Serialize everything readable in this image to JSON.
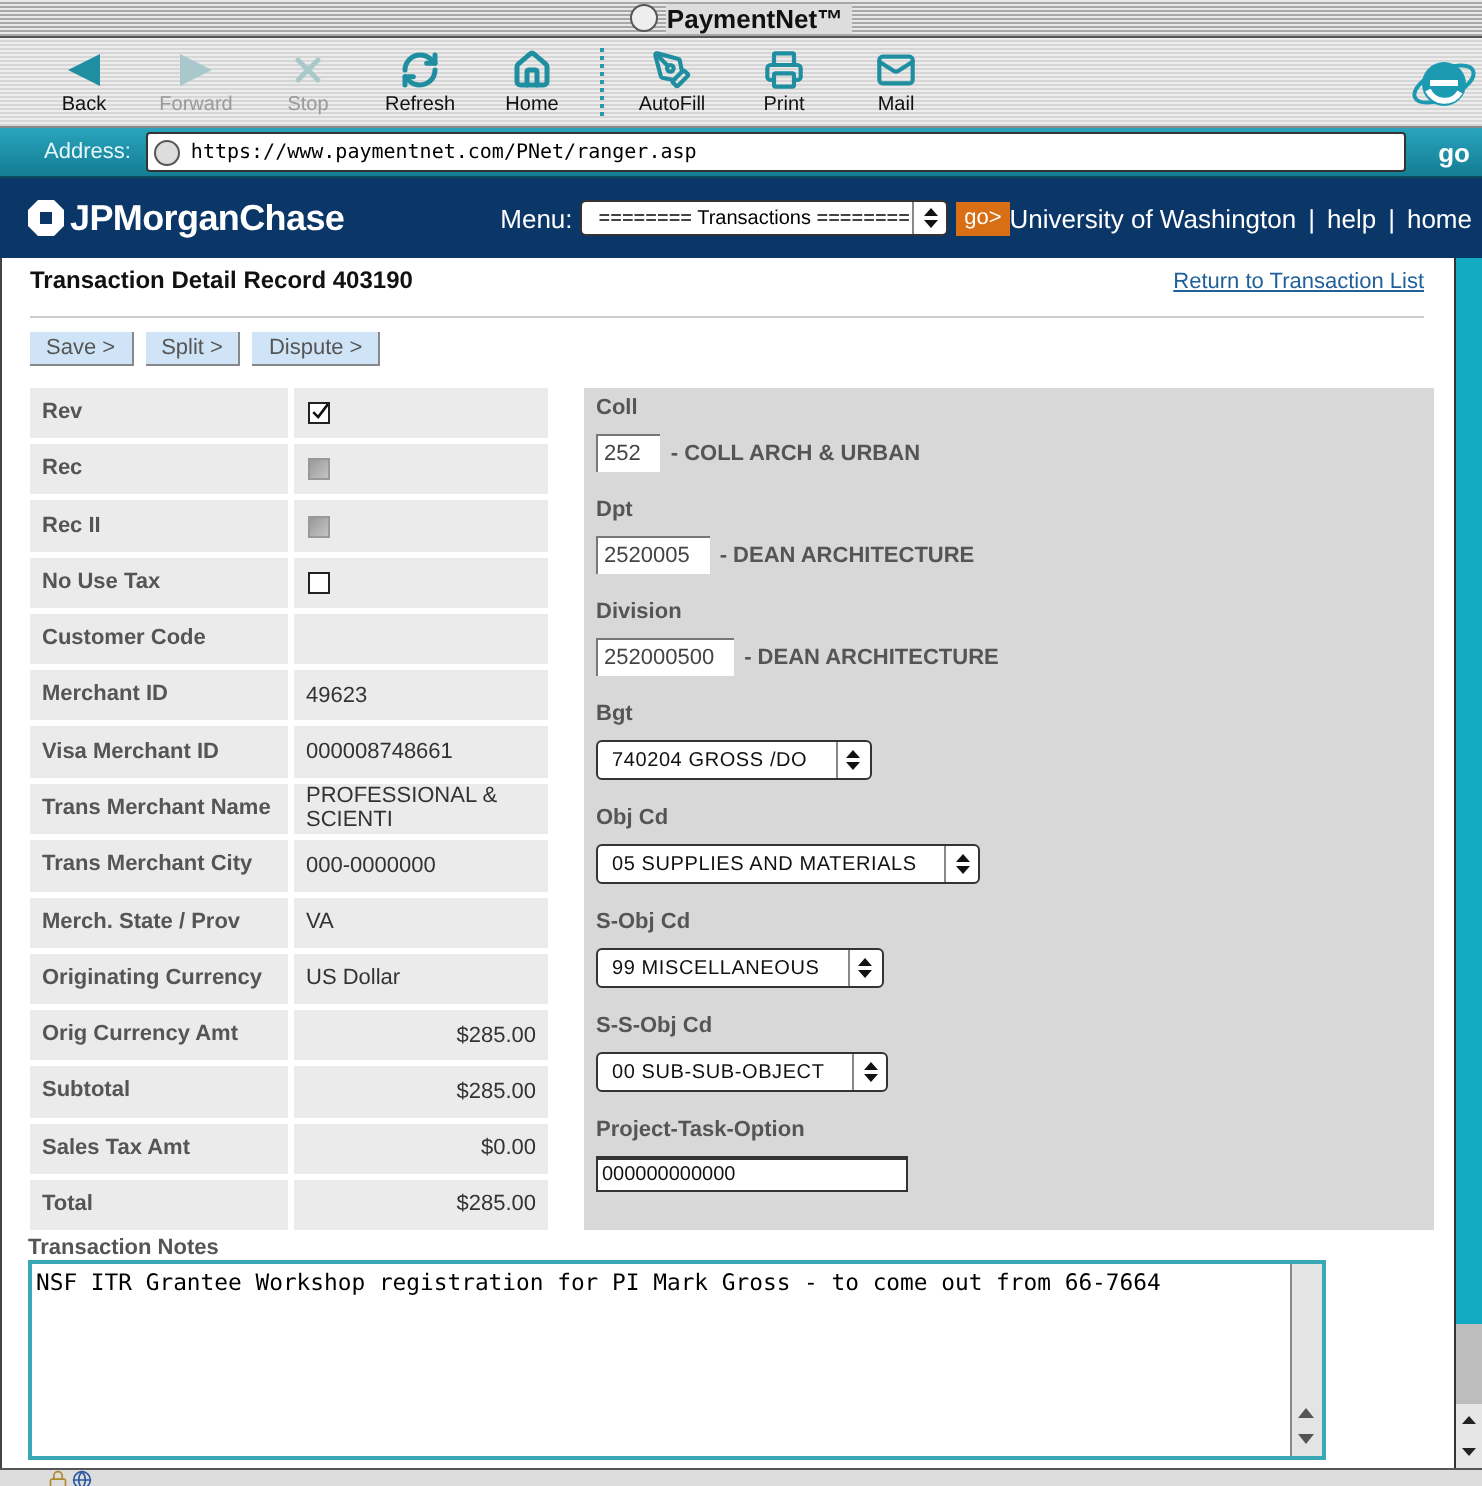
{
  "window": {
    "title": "PaymentNet™"
  },
  "toolbar": {
    "navigation": [
      {
        "kind": "back",
        "label": "Back",
        "disabled": false
      },
      {
        "kind": "forward",
        "label": "Forward",
        "disabled": true
      },
      {
        "kind": "stop",
        "label": "Stop",
        "disabled": true
      },
      {
        "kind": "refresh",
        "label": "Refresh",
        "disabled": false
      },
      {
        "kind": "home",
        "label": "Home",
        "disabled": false
      }
    ],
    "tools": [
      {
        "kind": "autofill",
        "label": "AutoFill",
        "disabled": false
      },
      {
        "kind": "print",
        "label": "Print",
        "disabled": false
      },
      {
        "kind": "mail",
        "label": "Mail",
        "disabled": false
      }
    ]
  },
  "address_bar": {
    "label": "Address:",
    "url": "https://www.paymentnet.com/PNet/ranger.asp",
    "go": "go"
  },
  "header": {
    "logo": "JPMorganChase",
    "menu_label": "Menu:",
    "menu_value": "======== Transactions ========",
    "go": "go>",
    "nav": [
      {
        "kind": "link",
        "text": "University of Washington"
      },
      {
        "kind": "separator",
        "text": "|"
      },
      {
        "kind": "link",
        "text": "help"
      },
      {
        "kind": "separator",
        "text": "|"
      },
      {
        "kind": "link",
        "text": "home"
      }
    ]
  },
  "page": {
    "title": "Transaction Detail Record 403190",
    "back_link": "Return to Transaction List",
    "actions": [
      "Save >",
      "Split >",
      "Dispute >"
    ]
  },
  "details": [
    {
      "label": "Rev",
      "kind": "checkbox",
      "checked": true,
      "disabled": false
    },
    {
      "label": "Rec",
      "kind": "checkbox",
      "checked": false,
      "disabled": true
    },
    {
      "label": "Rec II",
      "kind": "checkbox",
      "checked": false,
      "disabled": true
    },
    {
      "label": "No Use Tax",
      "kind": "checkbox",
      "checked": false,
      "disabled": false
    },
    {
      "label": "Customer Code",
      "kind": "text"
    },
    {
      "label": "Merchant ID",
      "kind": "text",
      "value": "49623"
    },
    {
      "label": "Visa Merchant ID",
      "kind": "text",
      "value": "000008748661"
    },
    {
      "label": "Trans Merchant Name",
      "kind": "text",
      "value": "PROFESSIONAL & SCIENTI"
    },
    {
      "label": "Trans Merchant City",
      "kind": "text",
      "value": "000-0000000"
    },
    {
      "label": "Merch. State / Prov",
      "kind": "text",
      "value": "VA"
    },
    {
      "label": "Originating Currency",
      "kind": "text",
      "value": "US Dollar"
    },
    {
      "label": "Orig Currency Amt",
      "kind": "amount",
      "value": "$285.00"
    },
    {
      "label": "Subtotal",
      "kind": "amount",
      "value": "$285.00"
    },
    {
      "label": "Sales Tax Amt",
      "kind": "amount",
      "value": "$0.00"
    },
    {
      "label": "Total",
      "kind": "amount",
      "value": "$285.00"
    }
  ],
  "accounting": [
    {
      "label": "Coll",
      "kind": "code",
      "value": "252",
      "description": "- COLL ARCH & URBAN"
    },
    {
      "label": "Dpt",
      "kind": "code",
      "value": "2520005",
      "description": "- DEAN ARCHITECTURE"
    },
    {
      "label": "Division",
      "kind": "code",
      "value": "252000500",
      "description": "- DEAN ARCHITECTURE"
    },
    {
      "label": "Bgt",
      "kind": "select",
      "value": "740204 GROSS /DO"
    },
    {
      "label": "Obj Cd",
      "kind": "select",
      "value": "05 SUPPLIES AND MATERIALS"
    },
    {
      "label": "S-Obj Cd",
      "kind": "select",
      "value": "99 MISCELLANEOUS"
    },
    {
      "label": "S-S-Obj Cd",
      "kind": "select",
      "value": "00 SUB-SUB-OBJECT"
    },
    {
      "label": "Project-Task-Option",
      "kind": "input",
      "value": "000000000000"
    }
  ],
  "notes": {
    "label": "Transaction Notes",
    "value": "NSF ITR Grantee Workshop registration for PI Mark Gross - to come out from 66-7664"
  }
}
